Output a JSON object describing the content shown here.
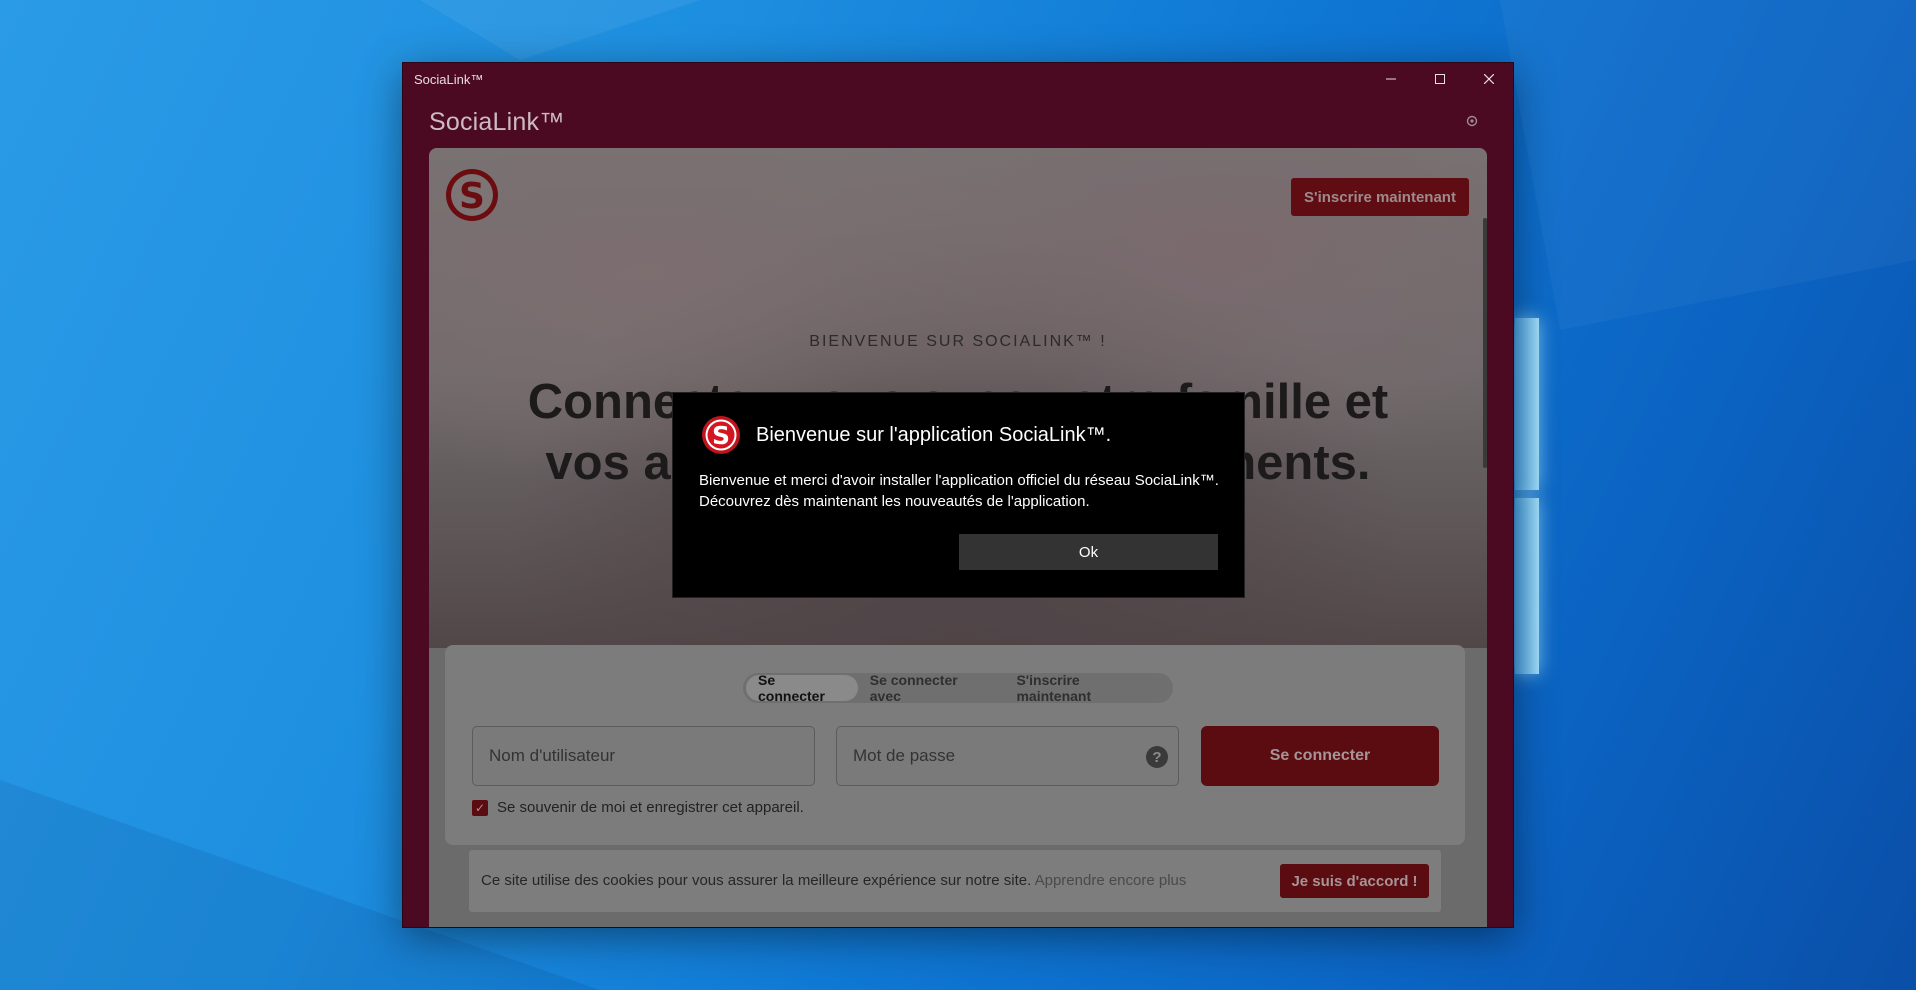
{
  "window": {
    "titlebar": "SociaLink™",
    "app_title": "SociaLink™"
  },
  "content": {
    "signup_top": "S'inscrire maintenant",
    "kicker": "BIENVENUE SUR SOCIALINK™ !",
    "headline_line1": "Connectez-vous avec votre famille et",
    "headline_line2": "vos amis et partagez vos moments."
  },
  "login": {
    "tabs": [
      "Se connecter",
      "Se connecter avec",
      "S'inscrire maintenant"
    ],
    "username_placeholder": "Nom d'utilisateur",
    "password_placeholder": "Mot de passe",
    "help_icon_glyph": "?",
    "submit": "Se connecter",
    "remember": "Se souvenir de moi et enregistrer cet appareil.",
    "remember_checked": true
  },
  "cookie": {
    "text": "Ce site utilise des cookies pour vous assurer la meilleure expérience sur notre site.",
    "link": "Apprendre encore plus",
    "accept": "Je suis d'accord !"
  },
  "dialog": {
    "title": "Bienvenue sur l'application SociaLink™.",
    "body_line1": "Bienvenue et merci d'avoir installer l'application officiel du réseau SociaLink™.",
    "body_line2": "Découvrez dès maintenant les nouveautés de l'application.",
    "ok": "Ok"
  },
  "colors": {
    "window_frame": "#4b0a22",
    "brand_red": "#c0141c",
    "dialog_bg": "#000000",
    "desktop_blue": "#0f78d4"
  },
  "icons": {
    "minimize": "minimize-icon",
    "maximize": "maximize-icon",
    "close": "close-icon",
    "settings": "gear-icon",
    "logo": "socialink-logo"
  }
}
